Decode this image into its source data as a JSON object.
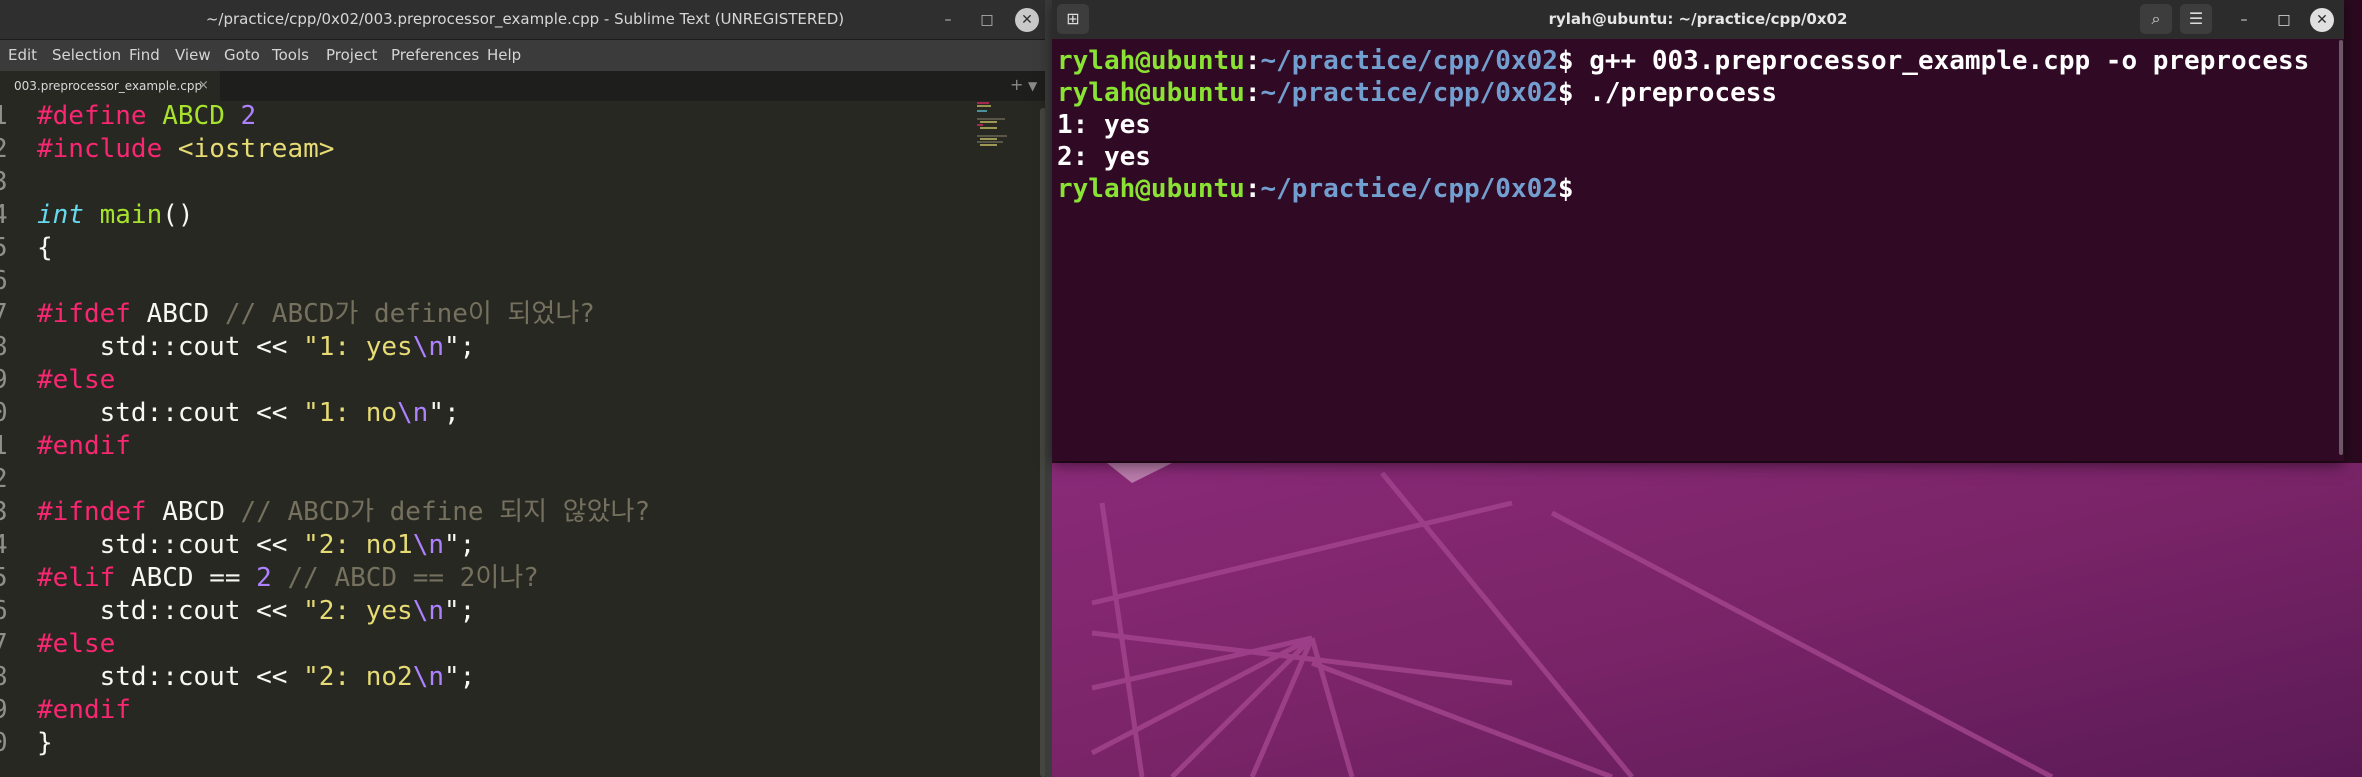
{
  "sublime": {
    "title": "~/practice/cpp/0x02/003.preprocessor_example.cpp - Sublime Text (UNREGISTERED)",
    "menu": [
      "Edit",
      "Selection",
      "Find",
      "View",
      "Goto",
      "Tools",
      "Project",
      "Preferences",
      "Help"
    ],
    "tab": {
      "label": "003.preprocessor_example.cpp",
      "close": "×"
    },
    "gutter": [
      "1",
      "2",
      "3",
      "4",
      "5",
      "6",
      "7",
      "8",
      "9",
      "0",
      "1",
      "2",
      "3",
      "4",
      "5",
      "6",
      "7",
      "8",
      "9",
      "0"
    ],
    "code": {
      "l1": [
        "#define",
        "ABCD",
        "2"
      ],
      "l2": [
        "#include",
        "<iostream>"
      ],
      "l4": [
        "int",
        "main",
        "()"
      ],
      "l5": "{",
      "l7": [
        "#ifdef",
        " ABCD ",
        "// ABCD가 define이 되었나?"
      ],
      "l8": [
        "    std::cout << ",
        "\"1: yes",
        "\\n",
        "\";"
      ],
      "l9": "#else",
      "l10": [
        "    std::cout << ",
        "\"1: no",
        "\\n",
        "\";"
      ],
      "l11": "#endif",
      "l13": [
        "#ifndef",
        " ABCD ",
        "// ABCD가 define 되지 않았나?"
      ],
      "l14": [
        "    std::cout << ",
        "\"2: no1",
        "\\n",
        "\";"
      ],
      "l15": [
        "#elif",
        " ABCD == ",
        "2",
        " // ABCD == 2이나?"
      ],
      "l16": [
        "    std::cout << ",
        "\"2: yes",
        "\\n",
        "\";"
      ],
      "l17": "#else",
      "l18": [
        "    std::cout << ",
        "\"2: no2",
        "\\n",
        "\";"
      ],
      "l19": "#endif",
      "l20": "}"
    }
  },
  "terminal": {
    "title": "rylah@ubuntu: ~/practice/cpp/0x02",
    "user": "rylah@ubuntu",
    "path": "~/practice/cpp/0x02",
    "prompt_sep": ":",
    "prompt_end": "$",
    "cmd1": " g++ 003.preprocessor_example.cpp -o preprocess",
    "cmd2": " ./preprocess",
    "out1": "1: yes",
    "out2": "2: yes"
  },
  "colors": {
    "editor_bg": "#272822",
    "terminal_bg": "#300a24",
    "prompt_user": "#8ae234",
    "prompt_path": "#729fcf"
  }
}
